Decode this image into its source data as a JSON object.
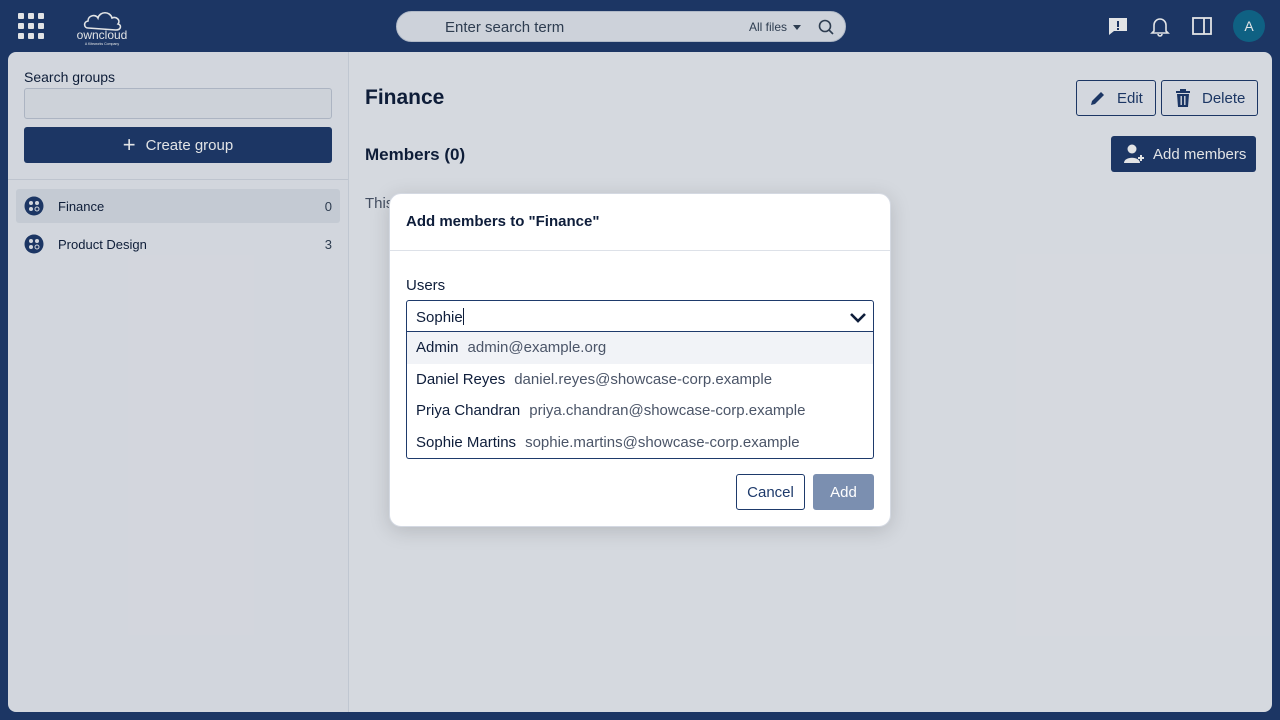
{
  "topbar": {
    "logo_text": "owncloud",
    "logo_subtext": "A Kiteworks Company",
    "search_placeholder": "Enter search term",
    "search_scope": "All files",
    "avatar_initial": "A"
  },
  "sidebar": {
    "search_label": "Search groups",
    "search_value": "",
    "create_button": "Create group",
    "groups": [
      {
        "name": "Finance",
        "count": "0"
      },
      {
        "name": "Product Design",
        "count": "3"
      }
    ]
  },
  "detail": {
    "title": "Finance",
    "edit_label": "Edit",
    "delete_label": "Delete",
    "members_title": "Members (0)",
    "add_members_label": "Add members",
    "empty_text": "This"
  },
  "modal": {
    "title": "Add members to \"Finance\"",
    "users_label": "Users",
    "users_value": "Sophie",
    "options": [
      {
        "name": "Admin",
        "email": "admin@example.org"
      },
      {
        "name": "Daniel Reyes",
        "email": "daniel.reyes@showcase-corp.example"
      },
      {
        "name": "Priya Chandran",
        "email": "priya.chandran@showcase-corp.example"
      },
      {
        "name": "Sophie Martins",
        "email": "sophie.martins@showcase-corp.example"
      }
    ],
    "cancel_label": "Cancel",
    "add_label": "Add"
  },
  "colors": {
    "brand": "#1e3a6b",
    "avatar": "#0f6a8f",
    "disabled_button": "#7b8fb0"
  }
}
